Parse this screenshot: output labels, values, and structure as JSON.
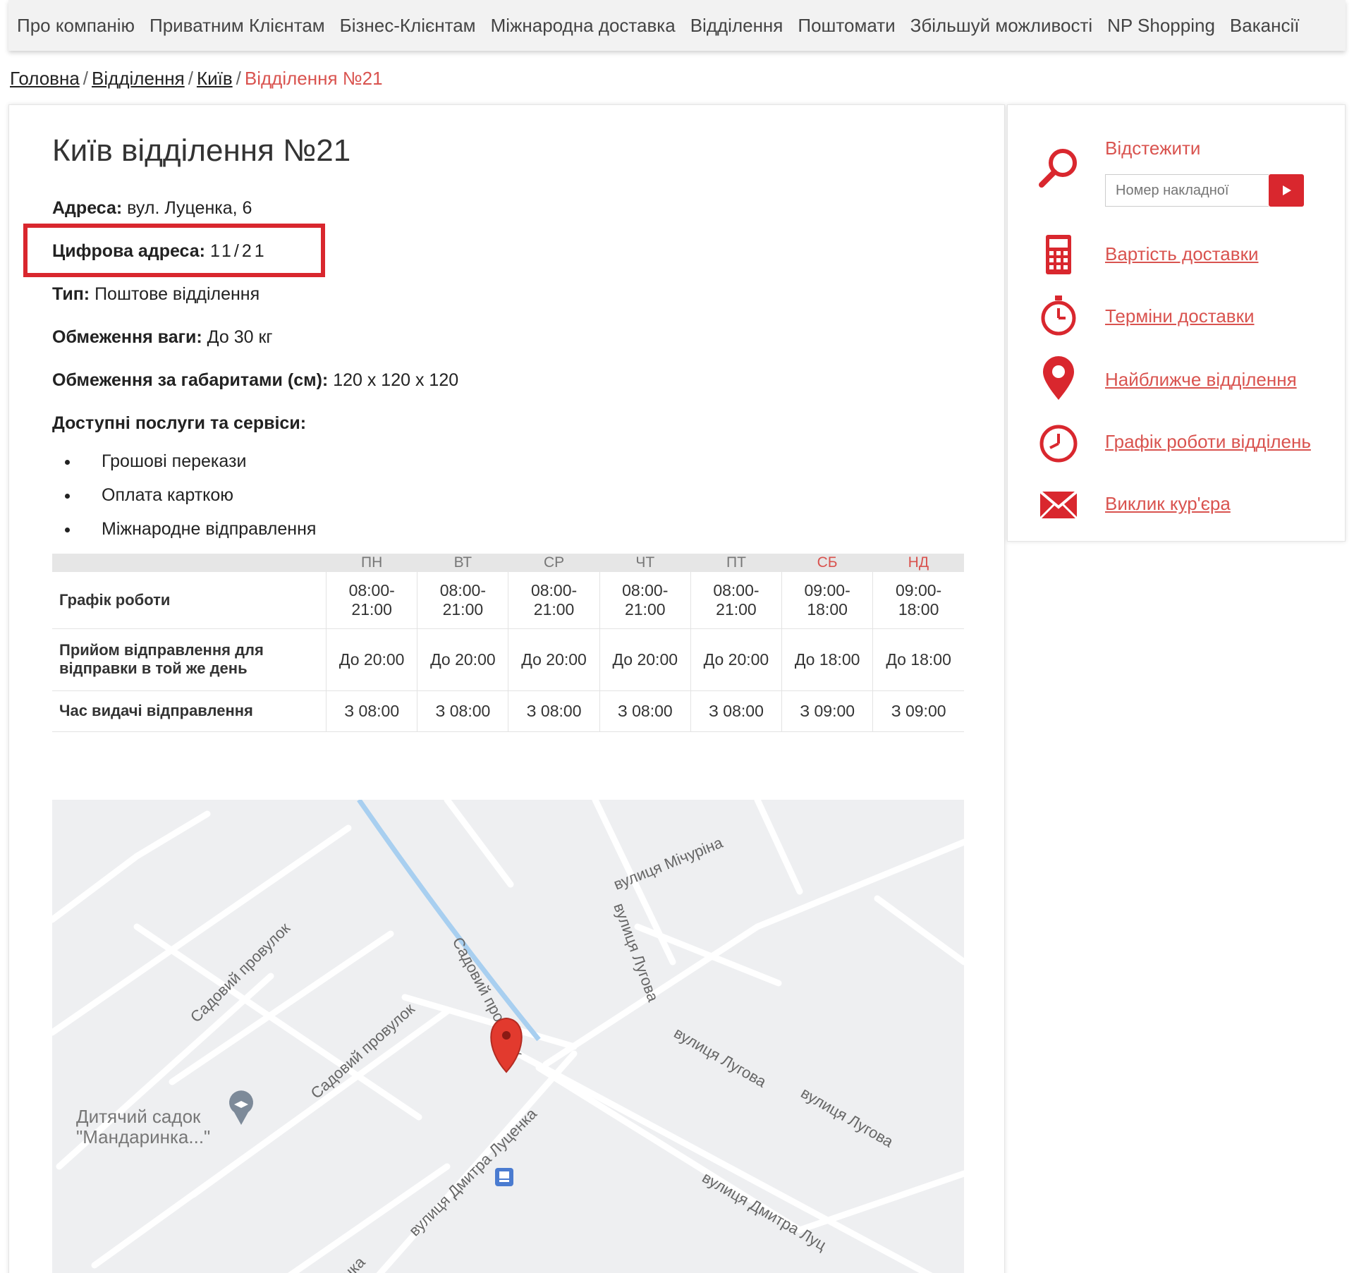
{
  "nav": {
    "items": [
      "Про компанію",
      "Приватним Клієнтам",
      "Бізнес-Клієнтам",
      "Міжнародна доставка",
      "Відділення",
      "Поштомати",
      "Збільшуй можливості",
      "NP Shopping",
      "Вакансії"
    ]
  },
  "breadcrumb": {
    "home": "Головна",
    "branches": "Відділення",
    "city": "Київ",
    "current": "Відділення №21",
    "separator": "/"
  },
  "branch": {
    "title": "Київ відділення №21",
    "address_label": "Адреса:",
    "address_value": "вул. Луценка, 6",
    "digital_label": "Цифрова адреса:",
    "digital_value": "11/21",
    "type_label": "Тип:",
    "type_value": "Поштове відділення",
    "weight_label": "Обмеження ваги:",
    "weight_value": "До 30 кг",
    "size_label": "Обмеження за габаритами (см):",
    "size_value": "120 x 120 x 120",
    "services_label": "Доступні послуги та сервіси:",
    "services": [
      "Грошові перекази",
      "Оплата карткою",
      "Міжнародне відправлення"
    ]
  },
  "schedule": {
    "days": [
      "ПН",
      "ВТ",
      "СР",
      "ЧТ",
      "ПТ",
      "СБ",
      "НД"
    ],
    "weekend_color": "#d9534f",
    "rows": [
      {
        "label": "Графік роботи",
        "values": [
          "08:00-\n21:00",
          "08:00-\n21:00",
          "08:00-\n21:00",
          "08:00-\n21:00",
          "08:00-\n21:00",
          "09:00-\n18:00",
          "09:00-\n18:00"
        ]
      },
      {
        "label": "Прийом відправлення для відправки в той же день",
        "values": [
          "До 20:00",
          "До 20:00",
          "До 20:00",
          "До 20:00",
          "До 20:00",
          "До 18:00",
          "До 18:00"
        ]
      },
      {
        "label": "Час видачі відправлення",
        "values": [
          "З 08:00",
          "З 08:00",
          "З 08:00",
          "З 08:00",
          "З 08:00",
          "З 09:00",
          "З 09:00"
        ]
      }
    ]
  },
  "map": {
    "streets": [
      "вулиця Мічуріна",
      "вулиця Лугова",
      "вулиця Лугова",
      "вулиця Лугова",
      "Садовий провулок",
      "Садовий провулок",
      "Садовий провулок",
      "вулиця Дмитра Луценка",
      "вулиця Дмитра Луц",
      "енка"
    ],
    "poi_name": "Дитячий садок",
    "poi_sub": "\"Мандаринка...\""
  },
  "sidebar": {
    "track_label": "Відстежити",
    "track_placeholder": "Номер накладної",
    "links": [
      "Вартість доставки",
      "Терміни доставки",
      "Найближче відділення",
      "Графік роботи відділень",
      "Виклик кур'єра"
    ],
    "accent": "#d9272e"
  }
}
